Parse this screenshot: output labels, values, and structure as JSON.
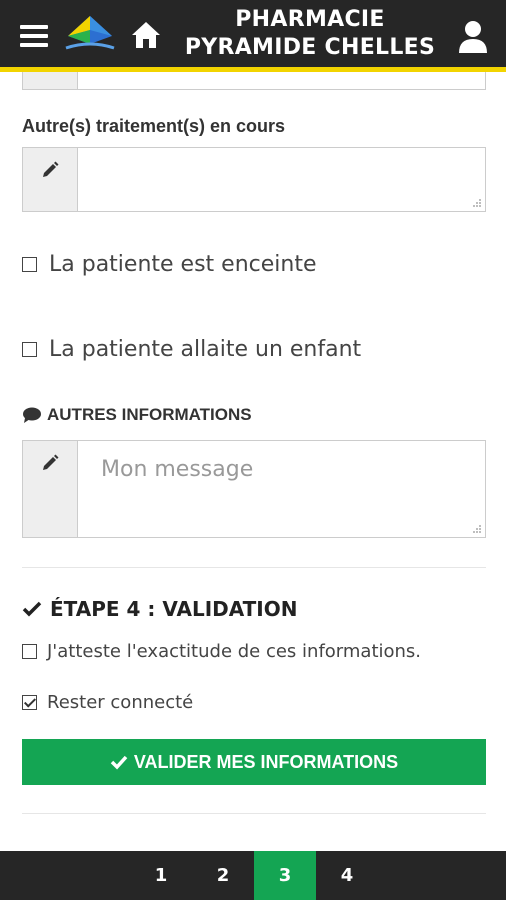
{
  "header": {
    "title_line1": "PHARMACIE",
    "title_line2": "PYRAMIDE CHELLES"
  },
  "form": {
    "other_treatments_label": "Autre(s) traitement(s) en cours",
    "other_treatments_value": "",
    "pregnant_label": "La patiente est enceinte",
    "pregnant_checked": false,
    "breastfeeding_label": "La patiente allaite un enfant",
    "breastfeeding_checked": false,
    "other_info_title": "AUTRES INFORMATIONS",
    "message_placeholder": "Mon message"
  },
  "validation": {
    "step_title": "ÉTAPE 4 : VALIDATION",
    "attest_label": "J'atteste l'exactitude de ces informations.",
    "attest_checked": false,
    "stay_connected_label": "Rester connecté",
    "stay_connected_checked": true,
    "submit_label": "VALIDER MES INFORMATIONS"
  },
  "pagination": {
    "pages": [
      "1",
      "2",
      "3",
      "4"
    ],
    "active": "3"
  },
  "colors": {
    "header_bg": "#262626",
    "header_accent": "#f2d400",
    "primary_green": "#14a553"
  }
}
